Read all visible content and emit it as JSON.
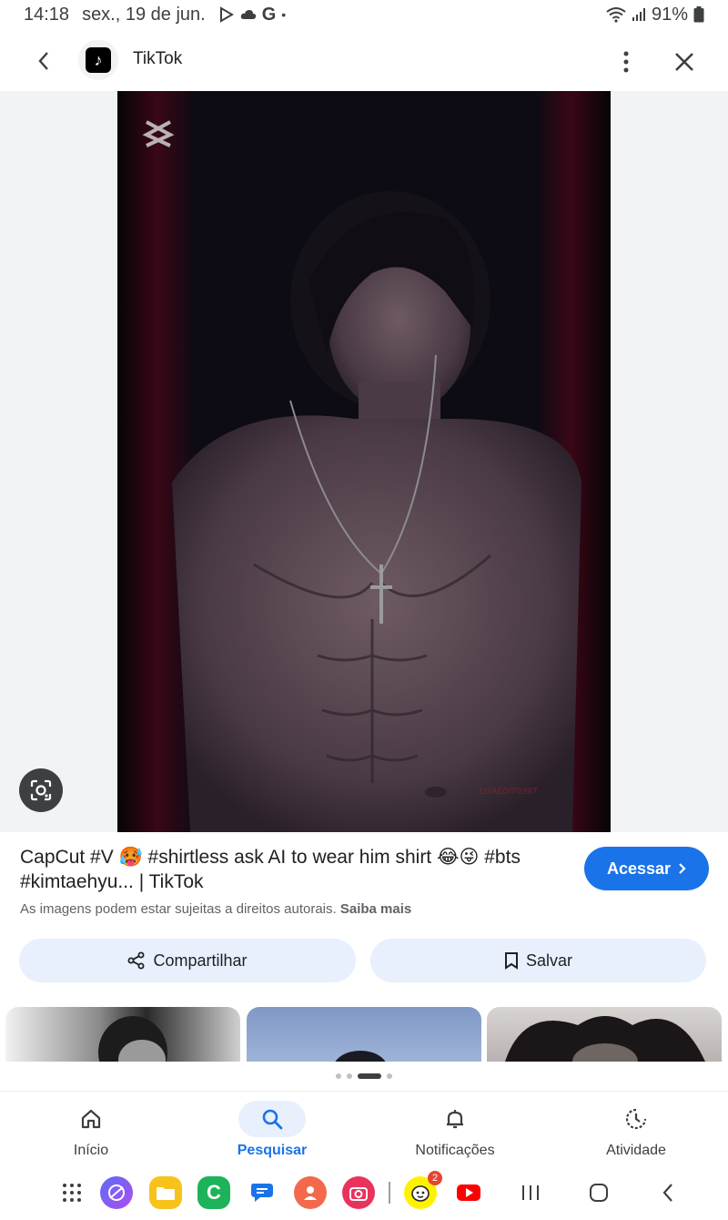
{
  "status_bar": {
    "time": "14:18",
    "date": "sex., 19 de jun.",
    "google_letter": "G",
    "battery": "91%"
  },
  "app_bar": {
    "site_name": "TikTok"
  },
  "result": {
    "title": "CapCut #V 🥵 #shirtless ask AI to wear him shirt 😂😜 #bts #kimtaehyu... | TikTok",
    "access_label": "Acessar",
    "copyright_text": "As imagens podem estar sujeitas a direitos autorais.",
    "learn_more": "Saiba mais",
    "share_label": "Compartilhar",
    "save_label": "Salvar"
  },
  "photo": {
    "watermark": "LISAEDIT0397"
  },
  "bottom_nav": [
    {
      "label": "Início",
      "icon": "home-icon"
    },
    {
      "label": "Pesquisar",
      "icon": "search-icon"
    },
    {
      "label": "Notificações",
      "icon": "bell-icon"
    },
    {
      "label": "Atividade",
      "icon": "activity-icon"
    }
  ],
  "dock": {
    "notification_badge": "2"
  },
  "colors": {
    "accent": "#1a73e8",
    "pill_bg": "#e8f0fe"
  }
}
